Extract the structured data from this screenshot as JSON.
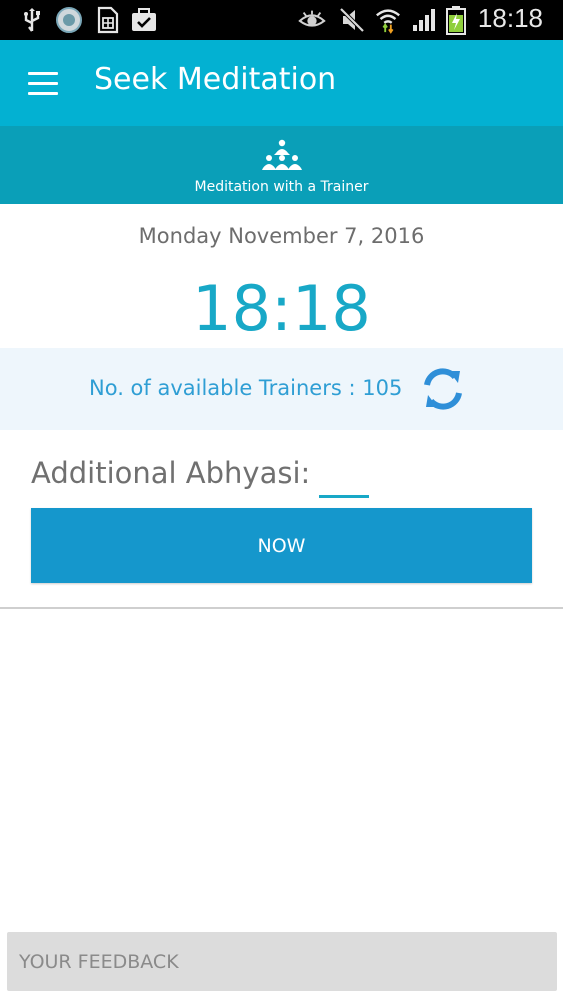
{
  "status_bar": {
    "time": "18:18",
    "icons": [
      "usb-icon",
      "app-circle-icon",
      "sim-card-icon",
      "task-icon",
      "eye-icon",
      "mute-icon",
      "wifi-icon",
      "signal-icon",
      "battery-icon"
    ]
  },
  "app_bar": {
    "title": "Seek Meditation",
    "menu_icon": "hamburger-menu-icon"
  },
  "mode": {
    "label": "Meditation with a Trainer",
    "icon": "group-meditation-icon"
  },
  "date": "Monday November 7, 2016",
  "clock": "18:18",
  "trainers": {
    "label": "No. of available Trainers : 105",
    "refresh_icon": "refresh-icon"
  },
  "abhyasi": {
    "label": "Additional Abhyasi:",
    "value": ""
  },
  "now_button": "NOW",
  "feedback_button": "YOUR FEEDBACK",
  "colors": {
    "status_bar": "#000000",
    "app_bar": "#03b1d2",
    "mode_bar": "#0a9fb8",
    "clock_text": "#18a8c7",
    "trainers_text": "#2f9ed4",
    "now_button": "#1597cc",
    "feedback_button": "#dcdcdc"
  }
}
